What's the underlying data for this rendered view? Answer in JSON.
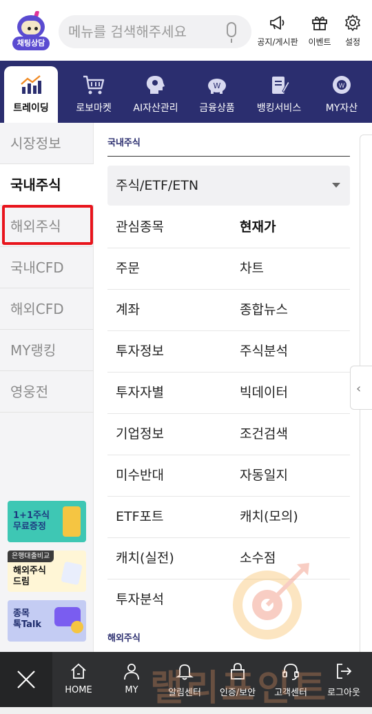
{
  "header": {
    "chatbot_label": "채팅상담",
    "search_placeholder": "메뉴를 검색해주세요",
    "notice_label": "공지/게시판",
    "event_label": "이벤트",
    "settings_label": "설정"
  },
  "topnav": {
    "tabs": [
      {
        "label": "트레이딩",
        "icon": "trading-chart-icon",
        "active": true
      },
      {
        "label": "로보마켓",
        "icon": "shopping-cart-icon"
      },
      {
        "label": "AI자산관리",
        "icon": "ai-head-icon"
      },
      {
        "label": "금융상품",
        "icon": "piggy-bank-icon"
      },
      {
        "label": "뱅킹서비스",
        "icon": "document-pen-icon"
      },
      {
        "label": "MY자산",
        "icon": "won-pie-icon"
      }
    ]
  },
  "sidebar": {
    "items": [
      {
        "label": "시장정보"
      },
      {
        "label": "국내주식",
        "active": true
      },
      {
        "label": "해외주식",
        "highlighted": true
      },
      {
        "label": "국내CFD"
      },
      {
        "label": "해외CFD"
      },
      {
        "label": "MY랭킹"
      },
      {
        "label": "영웅전"
      }
    ],
    "banners": [
      {
        "line1": "1+1주식",
        "line2": "무료증정"
      },
      {
        "tag": "은행대출비교",
        "line1": "해외주식",
        "line2": "드림"
      },
      {
        "line1": "종목",
        "line2": "톡Talk"
      }
    ]
  },
  "main": {
    "section_title": "국내주식",
    "dropdown_value": "주식/ETF/ETN",
    "menu": [
      [
        "관심종목",
        "현재가"
      ],
      [
        "주문",
        "차트"
      ],
      [
        "계좌",
        "종합뉴스"
      ],
      [
        "투자정보",
        "주식분석"
      ],
      [
        "투자자별",
        "빅데이터"
      ],
      [
        "기업정보",
        "조건검색"
      ],
      [
        "미수반대",
        "자동일지"
      ],
      [
        "ETF포트",
        "캐치(모의)"
      ],
      [
        "캐치(실전)",
        "소수점"
      ],
      [
        "투자분석",
        ""
      ]
    ],
    "next_section_title": "해외주식"
  },
  "bottombar": {
    "items": [
      {
        "label": "HOME",
        "icon": "home-icon"
      },
      {
        "label": "MY",
        "icon": "person-icon"
      },
      {
        "label": "알림센터",
        "icon": "bell-icon"
      },
      {
        "label": "인증/보안",
        "icon": "lock-icon"
      },
      {
        "label": "고객센터",
        "icon": "headset-icon"
      },
      {
        "label": "로그아웃",
        "icon": "logout-icon"
      }
    ],
    "watermark_text": "랠리포인트"
  }
}
